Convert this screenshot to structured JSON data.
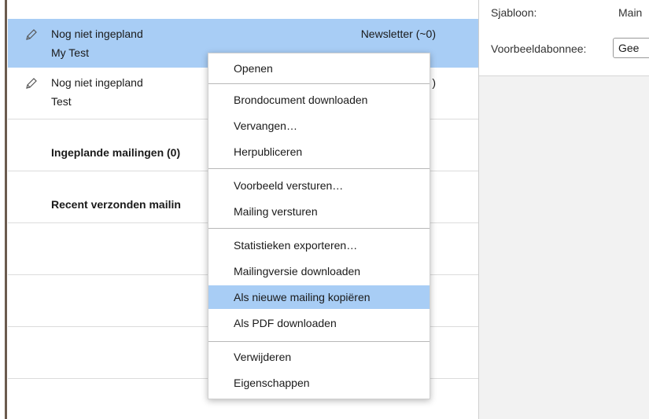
{
  "list": {
    "rows": [
      {
        "status": "Nog niet ingepland",
        "name": "My Test",
        "tag": "Newsletter (~0)",
        "icon": "pencil-icon"
      },
      {
        "status": "Nog niet ingepland",
        "name": "Test",
        "tag_visible_fragment": ")",
        "icon": "pencil-icon"
      }
    ],
    "sections": {
      "scheduled": "Ingeplande mailingen (0)",
      "recent": "Recent verzonden mailin"
    }
  },
  "right_panel": {
    "template_label": "Sjabloon:",
    "template_value": "Main",
    "example_label": "Voorbeeldabonnee:",
    "example_value": "Gee"
  },
  "context_menu": {
    "items": [
      "Openen",
      "Brondocument downloaden",
      "Vervangen…",
      "Herpubliceren",
      "Voorbeeld versturen…",
      "Mailing versturen",
      "Statistieken exporteren…",
      "Mailingversie downloaden",
      "Als nieuwe mailing kopiëren",
      "Als PDF downloaden",
      "Verwijderen",
      "Eigenschappen"
    ],
    "highlighted": "Als nieuwe mailing kopiëren"
  },
  "colors": {
    "selection": "#a8cdf5",
    "right_pane_bg": "#f2f2f2",
    "divider": "#dcdcdc"
  }
}
